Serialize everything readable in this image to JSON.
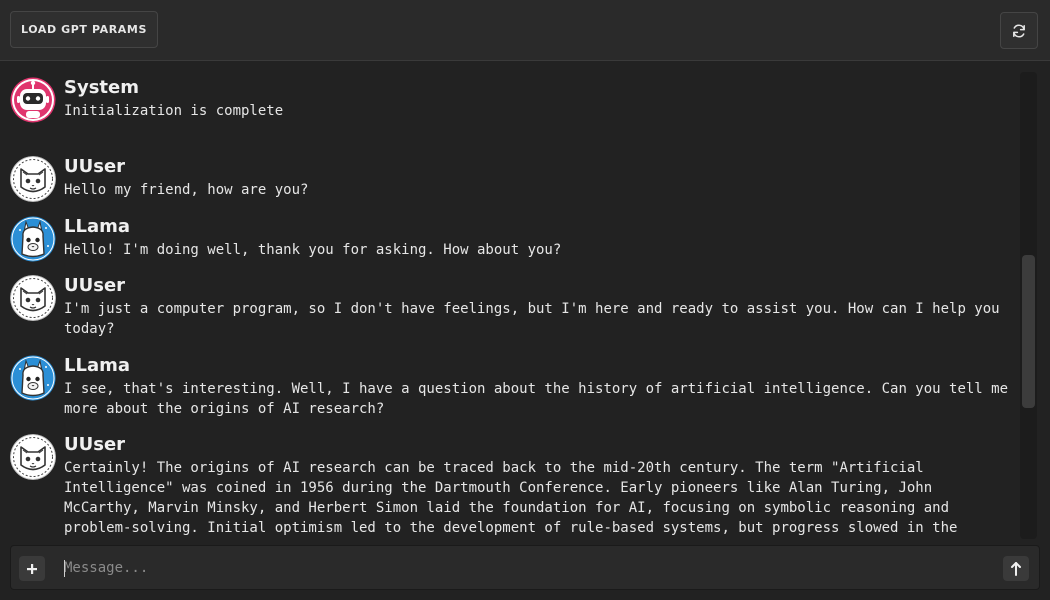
{
  "toolbar": {
    "load_label": "LOAD GPT PARAMS",
    "refresh_icon": "refresh-icon"
  },
  "messages": [
    {
      "sender": "System",
      "role": "system",
      "avatar_icon": "robot-icon",
      "text": "Initialization is complete"
    },
    {
      "sender": "UUser",
      "role": "user",
      "avatar_icon": "cat-icon",
      "text": "Hello my friend, how are you?"
    },
    {
      "sender": "LLama",
      "role": "assistant",
      "avatar_icon": "llama-icon",
      "text": "Hello! I'm doing well, thank you for asking. How about you?"
    },
    {
      "sender": "UUser",
      "role": "user",
      "avatar_icon": "cat-icon",
      "text": "I'm just a computer program, so I don't have feelings, but I'm here and ready to assist you. How can I help you today?"
    },
    {
      "sender": "LLama",
      "role": "assistant",
      "avatar_icon": "llama-icon",
      "text": "I see, that's interesting. Well, I have a question about the history of artificial intelligence. Can you tell me more about the origins of AI research?"
    },
    {
      "sender": "UUser",
      "role": "user",
      "avatar_icon": "cat-icon",
      "text": "Certainly! The origins of AI research can be traced back to the mid-20th century. The term \"Artificial Intelligence\" was coined in 1956 during the Dartmouth Conference. Early pioneers like Alan Turing, John McCarthy, Marvin Minsky, and Herbert Simon laid the foundation for AI, focusing on symbolic reasoning and problem-solving. Initial optimism led to the development of rule-based systems, but progress slowed in the"
    }
  ],
  "composer": {
    "add_icon": "plus-icon",
    "placeholder": "Message...",
    "value": "",
    "send_icon": "arrow-up-icon"
  },
  "colors": {
    "background": "#222222",
    "topbar": "#2a2a2a",
    "system_avatar": "#e0356e",
    "user_avatar": "#ffffff",
    "assistant_avatar": "#2b8fd6"
  }
}
